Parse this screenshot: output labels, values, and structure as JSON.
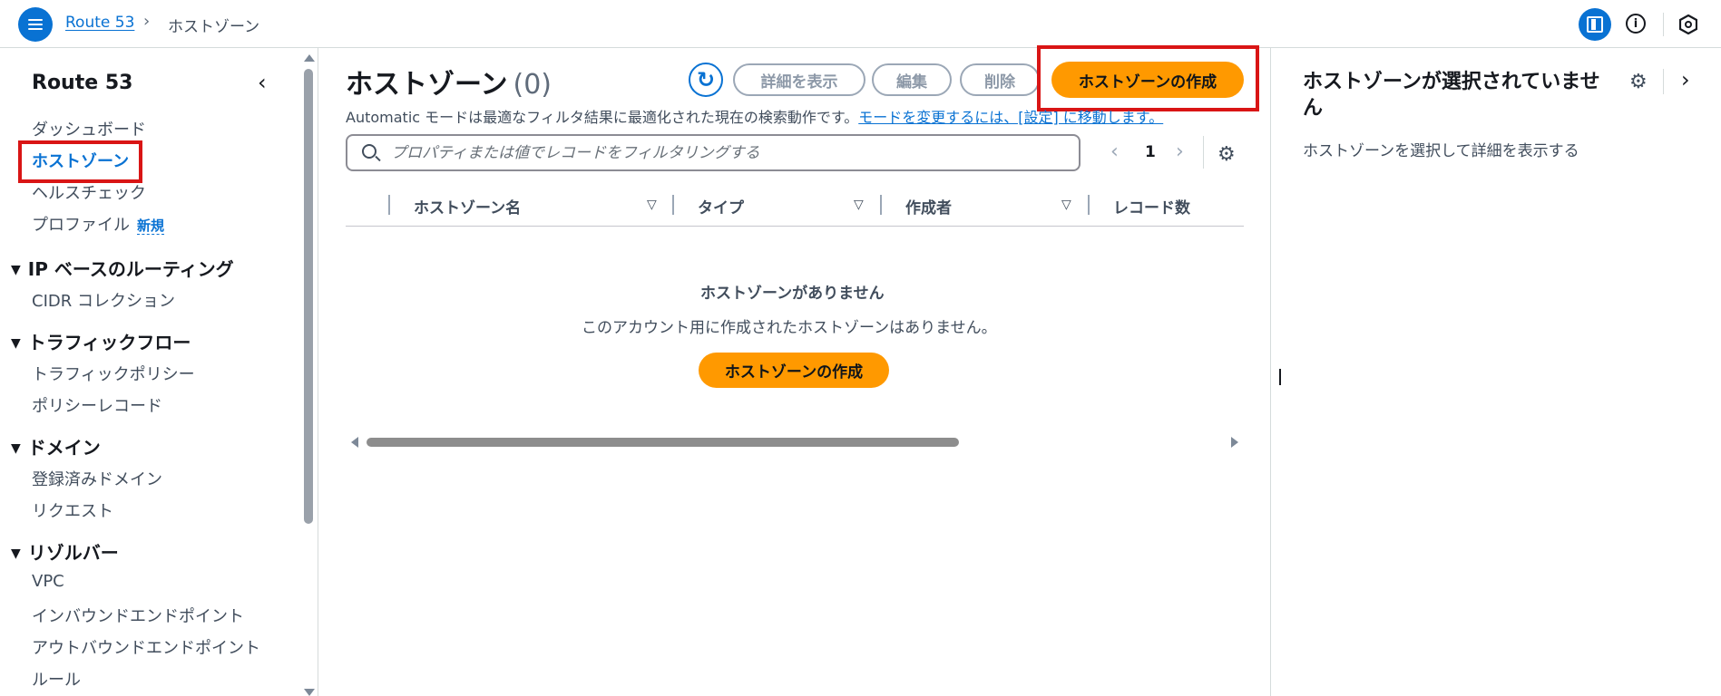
{
  "breadcrumb": {
    "root": "Route 53",
    "separator": "›",
    "current": "ホストゾーン"
  },
  "topbar": {
    "info_icon": "i"
  },
  "sidenav": {
    "title": "Route 53",
    "collapse_icon": "‹",
    "items": [
      {
        "label": "ダッシュボード"
      },
      {
        "label": "ホストゾーン"
      },
      {
        "label": "ヘルスチェック"
      },
      {
        "label": "プロファイル",
        "badge": "新規"
      }
    ],
    "sections": [
      {
        "title": "IP ベースのルーティング",
        "items": [
          "CIDR コレクション"
        ]
      },
      {
        "title": "トラフィックフロー",
        "items": [
          "トラフィックポリシー",
          "ポリシーレコード"
        ]
      },
      {
        "title": "ドメイン",
        "items": [
          "登録済みドメイン",
          "リクエスト"
        ]
      },
      {
        "title": "リゾルバー",
        "items": [
          "VPC",
          "インバウンドエンドポイント",
          "アウトバウンドエンドポイント",
          "ルール"
        ]
      }
    ]
  },
  "main": {
    "title": "ホストゾーン",
    "count": "(0)",
    "refresh_icon": "↻",
    "buttons": {
      "details": "詳細を表示",
      "edit": "編集",
      "delete": "削除",
      "create": "ホストゾーンの作成"
    },
    "info_text": "Automatic モードは最適なフィルタ結果に最適化された現在の検索動作です。",
    "info_link": "モードを変更するには、[設定] に移動します。",
    "search_placeholder": "プロパティまたは値でレコードをフィルタリングする",
    "pager": {
      "prev": "‹",
      "page": "1",
      "next": "›"
    },
    "settings_icon": "⚙",
    "columns": [
      "ホストゾーン名",
      "タイプ",
      "作成者",
      "レコード数"
    ],
    "sort_icon": "▽",
    "empty": {
      "title": "ホストゾーンがありません",
      "description": "このアカウント用に作成されたホストゾーンはありません。",
      "button": "ホストゾーンの作成"
    }
  },
  "panel": {
    "title": "ホストゾーンが選択されていません",
    "gear_icon": "⚙",
    "close_icon": "›",
    "description": "ホストゾーンを選択して詳細を表示する"
  },
  "colors": {
    "accent": "#0972d3",
    "primary_button": "#ff9900",
    "highlight": "#d91515"
  }
}
